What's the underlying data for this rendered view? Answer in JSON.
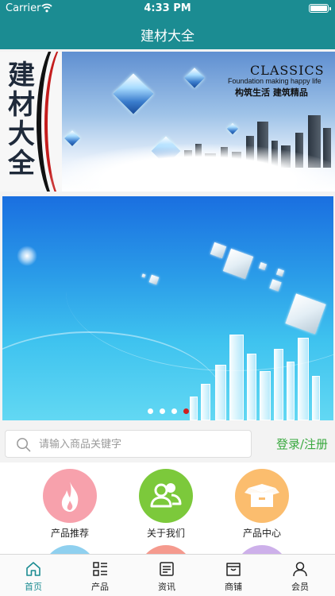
{
  "status_bar": {
    "carrier": "Carrier",
    "time": "4:33 PM",
    "battery_percent": 100
  },
  "nav": {
    "title": "建材大全"
  },
  "banner_top": {
    "vertical_text": "建材大全",
    "headline": "CLASSICS",
    "tagline_en": "Foundation making happy life",
    "tagline_cn": "构筑生活  建筑精品"
  },
  "carousel": {
    "slide_count": 4,
    "active_slide": 4
  },
  "search": {
    "placeholder": "请输入商品关键字",
    "value": ""
  },
  "login_link": "登录/注册",
  "categories": [
    {
      "label": "产品推荐",
      "color": "#f7a1ac",
      "icon": "flame-icon"
    },
    {
      "label": "关于我们",
      "color": "#7cc93b",
      "icon": "people-icon"
    },
    {
      "label": "产品中心",
      "color": "#fbbd6e",
      "icon": "box-icon"
    }
  ],
  "categories_row2_colors": [
    "#8fd0ef",
    "#f59a8e",
    "#cdb0ea"
  ],
  "tabs": [
    {
      "label": "首页",
      "icon": "home-icon",
      "active": true
    },
    {
      "label": "产品",
      "icon": "list-icon",
      "active": false
    },
    {
      "label": "资讯",
      "icon": "news-icon",
      "active": false
    },
    {
      "label": "商铺",
      "icon": "shop-icon",
      "active": false
    },
    {
      "label": "会员",
      "icon": "user-icon",
      "active": false
    }
  ],
  "colors": {
    "brand": "#1b8c92",
    "login_green": "#3aa93f",
    "carousel_active_dot": "#d01f1f"
  }
}
